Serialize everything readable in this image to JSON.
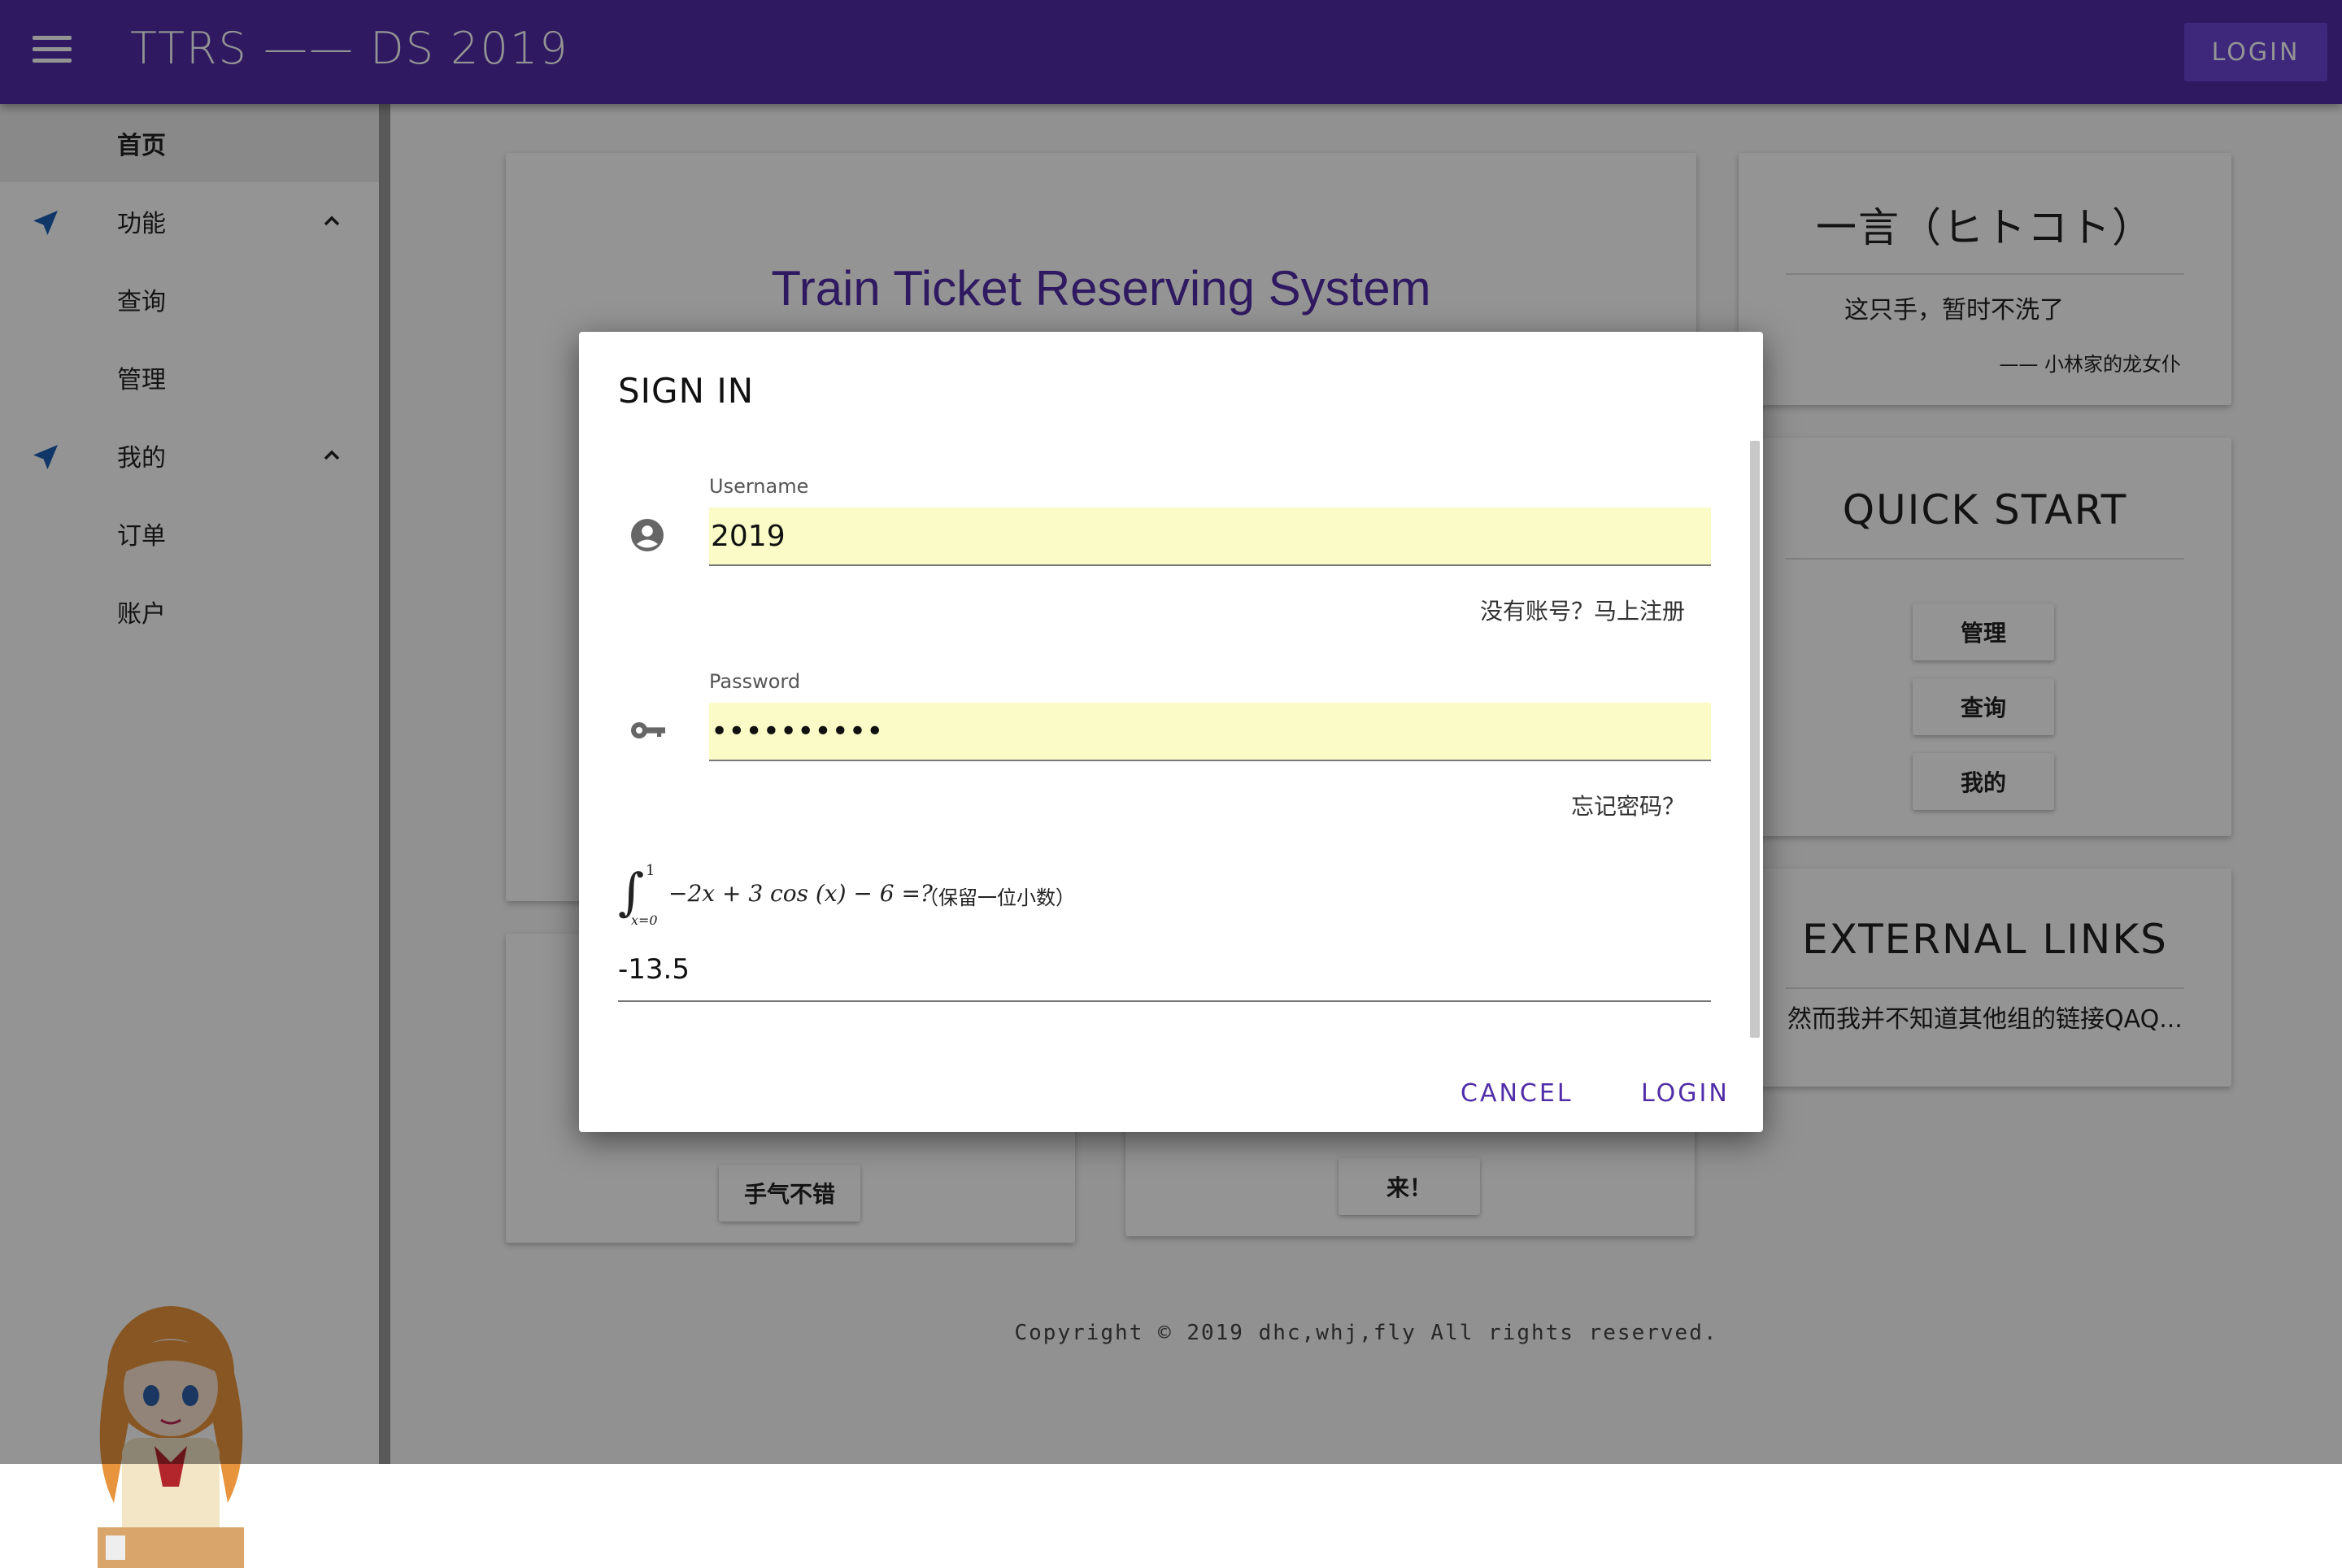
{
  "appbar": {
    "title": "TTRS —— DS 2019",
    "login_label": "LOGIN",
    "bar_color": "#512da8"
  },
  "sidebar": {
    "items": [
      {
        "label": "首页",
        "active": true
      },
      {
        "label": "功能",
        "icon": "navigation-arrow-icon",
        "expanded": true
      },
      {
        "label": "查询"
      },
      {
        "label": "管理"
      },
      {
        "label": "我的",
        "icon": "navigation-arrow-icon",
        "expanded": true
      },
      {
        "label": "订单"
      },
      {
        "label": "账户"
      }
    ]
  },
  "main": {
    "hero_title": "Train Ticket Reserving System",
    "hitokoto": {
      "title": "一言（ヒトコト）",
      "quote": "这只手，暂时不洗了",
      "source": "—— 小林家的龙女仆"
    },
    "quick_start": {
      "title": "QUICK START",
      "buttons": [
        "管理",
        "查询",
        "我的"
      ]
    },
    "external_links": {
      "title": "EXTERNAL LINKS",
      "text": "然而我并不知道其他组的链接QAQ..."
    },
    "bottom_cards": {
      "left_button": "手气不错",
      "right_button": "来！"
    },
    "footer": "Copyright © 2019 dhc,whj,fly All rights reserved."
  },
  "dialog": {
    "title": "SIGN IN",
    "username_label": "Username",
    "username_value": "2019",
    "register_link": "没有账号？马上注册",
    "password_label": "Password",
    "password_value": "••••••••••",
    "forgot_link": "忘记密码？",
    "captcha": {
      "upper_limit": "1",
      "lower_limit": "x=0",
      "expression": "−2x + 3 cos (x) − 6 =?",
      "hint": "（保留一位小数）",
      "answer": "-13.5"
    },
    "cancel_label": "CANCEL",
    "login_label": "LOGIN",
    "accent_color": "#512da8"
  }
}
